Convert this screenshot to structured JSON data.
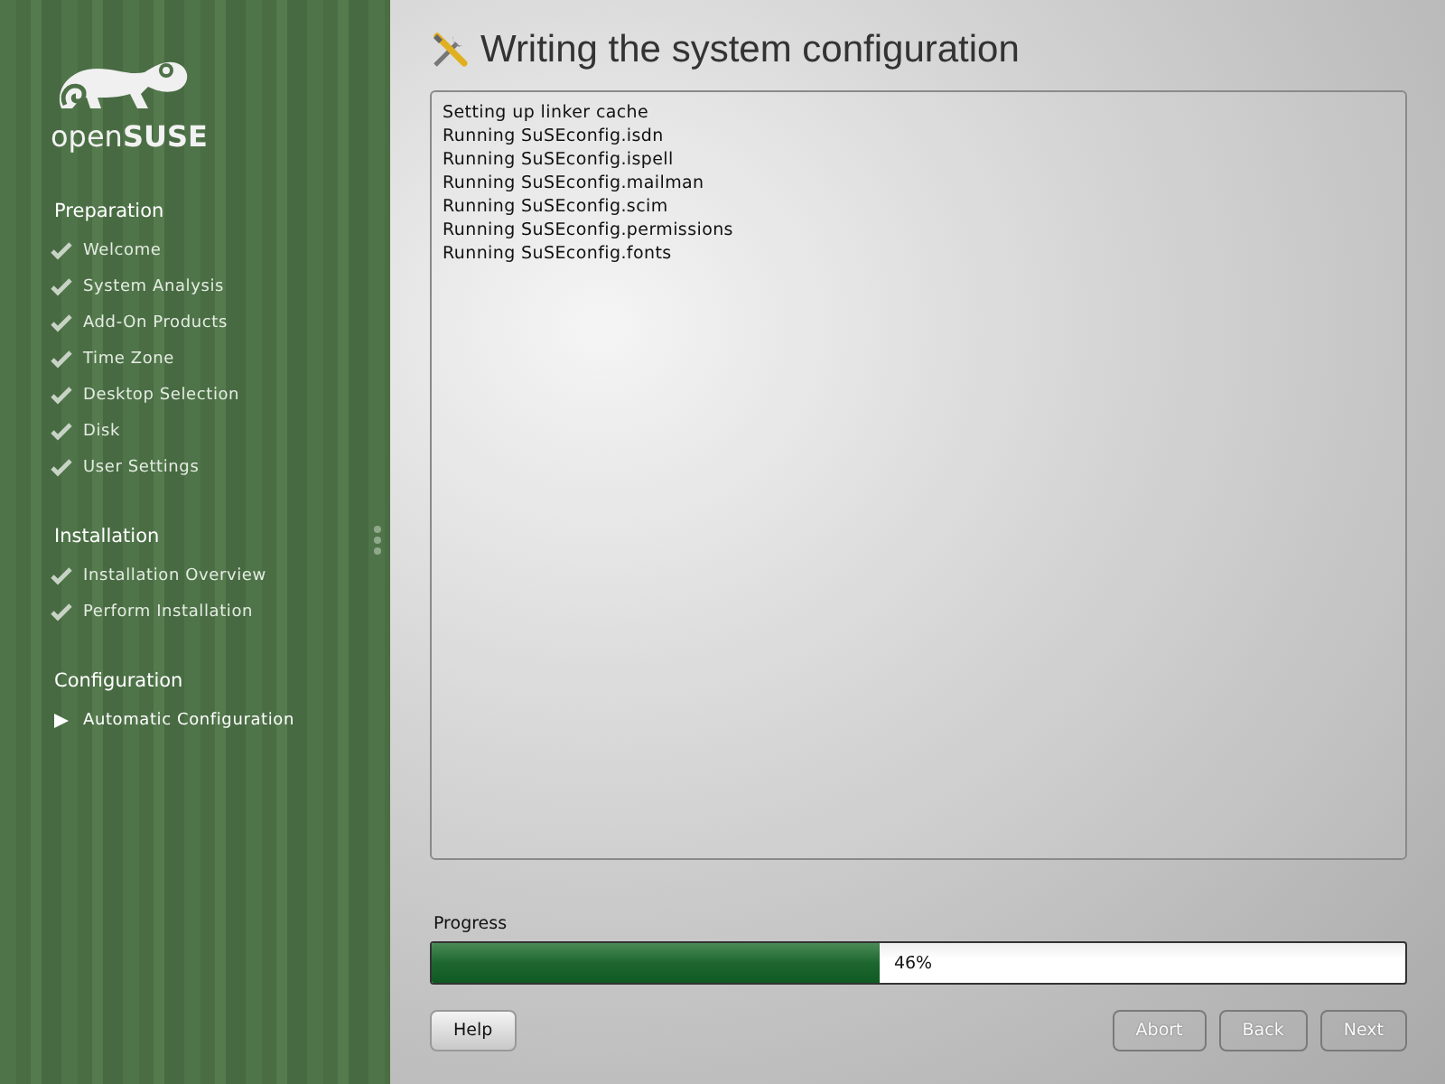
{
  "sidebar": {
    "logo": {
      "light": "open",
      "bold": "SUSE"
    },
    "sections": [
      {
        "title": "Preparation",
        "steps": [
          {
            "label": "Welcome",
            "kind": "done"
          },
          {
            "label": "System Analysis",
            "kind": "done"
          },
          {
            "label": "Add-On Products",
            "kind": "done"
          },
          {
            "label": "Time Zone",
            "kind": "done"
          },
          {
            "label": "Desktop Selection",
            "kind": "done"
          },
          {
            "label": "Disk",
            "kind": "done"
          },
          {
            "label": "User Settings",
            "kind": "done"
          }
        ]
      },
      {
        "title": "Installation",
        "steps": [
          {
            "label": "Installation Overview",
            "kind": "done"
          },
          {
            "label": "Perform Installation",
            "kind": "done"
          }
        ]
      },
      {
        "title": "Configuration",
        "steps": [
          {
            "label": "Automatic Configuration",
            "kind": "current"
          }
        ]
      }
    ]
  },
  "main": {
    "title": "Writing the system configuration",
    "log": [
      "Setting up linker cache",
      "Running SuSEconfig.isdn",
      "Running SuSEconfig.ispell",
      "Running SuSEconfig.mailman",
      "Running SuSEconfig.scim",
      "Running SuSEconfig.permissions",
      "Running SuSEconfig.fonts"
    ],
    "progress": {
      "label": "Progress",
      "level": 0.46,
      "reading": "46%"
    },
    "buttons": [
      {
        "label": "Help",
        "disabled": false
      },
      {
        "label": "Abort",
        "disabled": true
      },
      {
        "label": "Back",
        "disabled": true
      },
      {
        "label": "Next",
        "disabled": true
      }
    ]
  }
}
